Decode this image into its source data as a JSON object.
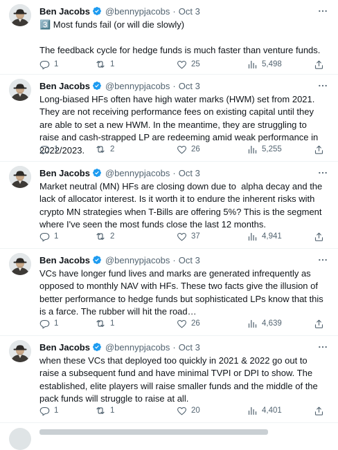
{
  "tweets": [
    {
      "author": "Ben Jacobs",
      "handle": "@bennypjacobs",
      "date": "Oct 3",
      "text": "3️⃣ Most funds fail (or will die slowly)\n\nThe feedback cycle for hedge funds is much faster than venture funds.",
      "replies": "1",
      "retweets": "1",
      "likes": "25",
      "views": "5,498"
    },
    {
      "author": "Ben Jacobs",
      "handle": "@bennypjacobs",
      "date": "Oct 3",
      "text": "Long-biased HFs often have high water marks (HWM) set from 2021. They are not receiving performance fees on existing capital until they are able to set a new HWM. In the meantime, they are struggling to raise and cash-strapped LP are redeeming amid weak performance in 2022/2023.",
      "replies": "1",
      "retweets": "2",
      "likes": "26",
      "views": "5,255"
    },
    {
      "author": "Ben Jacobs",
      "handle": "@bennypjacobs",
      "date": "Oct 3",
      "text": "Market neutral (MN) HFs are closing down due to  alpha decay and the lack of allocator interest. Is it worth it to endure the inherent risks with crypto MN strategies when T-Bills are offering 5%? This is the segment where I've seen the most funds close the last 12 months.",
      "replies": "1",
      "retweets": "2",
      "likes": "37",
      "views": "4,941"
    },
    {
      "author": "Ben Jacobs",
      "handle": "@bennypjacobs",
      "date": "Oct 3",
      "text": "VCs have longer fund lives and marks are generated infrequently as opposed to monthly NAV with HFs. These two facts give the illusion of better performance to hedge funds but sophisticated LPs know that this is a farce. The rubber will hit the road…",
      "replies": "1",
      "retweets": "1",
      "likes": "26",
      "views": "4,639"
    },
    {
      "author": "Ben Jacobs",
      "handle": "@bennypjacobs",
      "date": "Oct 3",
      "text": "when these VCs that deployed too quickly in 2021 & 2022 go out to raise a subsequent fund and have minimal TVPI or DPI to show. The established, elite players will raise smaller funds and the middle of the pack funds will struggle to raise at all.",
      "replies": "1",
      "retweets": "1",
      "likes": "20",
      "views": "4,401"
    }
  ],
  "colors": {
    "verified": "#1d9bf0",
    "secondary_text": "#536471",
    "primary_text": "#0f1419"
  },
  "icons": {
    "reply": "reply-icon",
    "retweet": "retweet-icon",
    "like": "like-icon",
    "views": "views-icon",
    "share": "share-icon",
    "more": "more-icon",
    "verified": "verified-icon"
  }
}
